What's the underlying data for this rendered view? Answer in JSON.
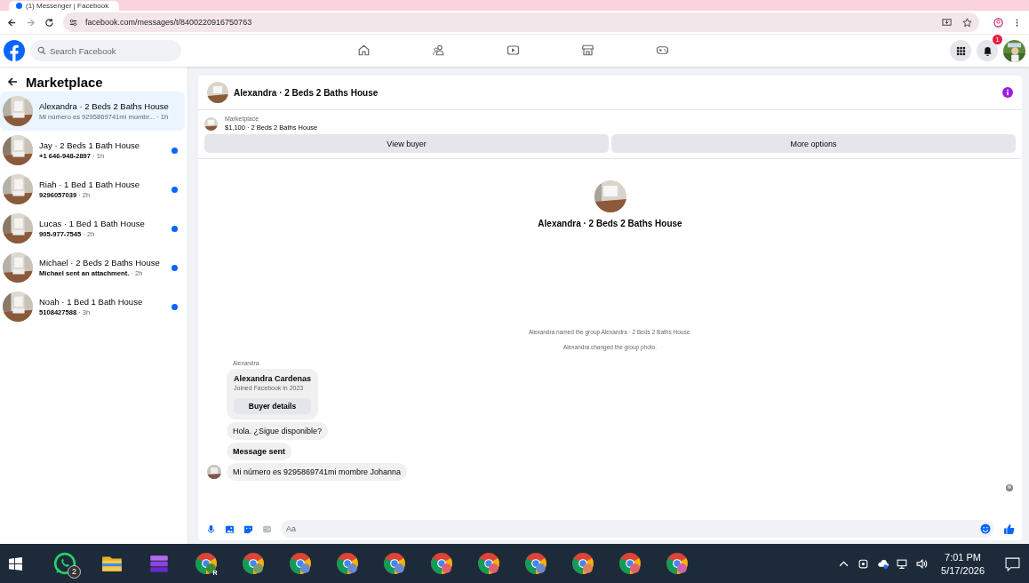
{
  "browser": {
    "tab_title": "(1) Messenger | Facebook",
    "url": "facebook.com/messages/t/8400220916750763"
  },
  "header": {
    "search_placeholder": "Search Facebook",
    "nav": [
      {
        "kind": "home",
        "selected": false
      },
      {
        "kind": "friends",
        "selected": false
      },
      {
        "kind": "video",
        "selected": false
      },
      {
        "kind": "marketplace",
        "selected": false
      },
      {
        "kind": "gaming",
        "selected": false
      }
    ],
    "notification_count": "1"
  },
  "sidebar": {
    "title": "Marketplace",
    "conversations": [
      {
        "title": "Alexandra · 2 Beds 2 Baths House",
        "preview": "Mi número es 9295869741mi mombr...",
        "time": "· 1h",
        "unread": false,
        "selected": true
      },
      {
        "title": "Jay · 2 Beds 1 Bath House",
        "preview": "+1 646-948-2897",
        "time": "· 1h",
        "unread": true,
        "selected": false
      },
      {
        "title": "Riah · 1 Bed 1 Bath House",
        "preview": "9296057039",
        "time": "· 2h",
        "unread": true,
        "selected": false
      },
      {
        "title": "Lucas · 1 Bed 1 Bath House",
        "preview": "905-977-7545",
        "time": "· 2h",
        "unread": true,
        "selected": false
      },
      {
        "title": "Michael · 2 Beds 2 Baths House",
        "preview": "Michael sent an attachment.",
        "time": "· 2h",
        "unread": true,
        "selected": false
      },
      {
        "title": "Noah · 1 Bed 1 Bath House",
        "preview": "5108427588",
        "time": "· 3h",
        "unread": true,
        "selected": false
      }
    ]
  },
  "chat": {
    "title": "Alexandra · 2 Beds 2 Baths House",
    "listing": {
      "source": "Marketplace",
      "summary": "$1,100 · 2 Beds 2 Baths House"
    },
    "buttons": [
      "View buyer",
      "More options"
    ],
    "intro_name": "Alexandra · 2 Beds 2 Baths House",
    "events": [
      "Alexandra named the group Alexandra · 2 Beds 2 Baths House.",
      "Alexandra changed the group photo."
    ],
    "sender": "Alexandra",
    "buyer_card": {
      "name": "Alexandra Cardenas",
      "joined": "Joined Facebook in 2023",
      "button": "Buyer details"
    },
    "messages": [
      {
        "text": "Hola. ¿Sigue disponible?",
        "bold": false,
        "avatar": false
      },
      {
        "text": "Message sent",
        "bold": true,
        "avatar": false
      },
      {
        "text": "Mi número es 9295869741mi mombre Johanna",
        "bold": false,
        "avatar": true
      }
    ],
    "composer_placeholder": "Aa"
  },
  "taskbar": {
    "apps": [
      {
        "kind": "whatsapp",
        "badge": "2"
      },
      {
        "kind": "folder"
      },
      {
        "kind": "stack"
      },
      {
        "kind": "chrome",
        "profile": "R",
        "color": "#3c8c3c"
      },
      {
        "kind": "chrome",
        "color": "#7a9a6a"
      },
      {
        "kind": "chrome",
        "color": "#6a8ad0"
      },
      {
        "kind": "chrome",
        "color": "#6a8ad0"
      },
      {
        "kind": "chrome",
        "color": "#6a8ad0"
      },
      {
        "kind": "chrome",
        "color": "#e06070"
      },
      {
        "kind": "chrome",
        "color": "#e06070"
      },
      {
        "kind": "chrome",
        "color": "#6a8ad0"
      },
      {
        "kind": "chrome",
        "color": "#e08060"
      },
      {
        "kind": "chrome",
        "color": "#e06070"
      },
      {
        "kind": "chrome",
        "color": "#d060b0"
      }
    ],
    "time": "7:01 PM",
    "date": "5/17/2026"
  }
}
